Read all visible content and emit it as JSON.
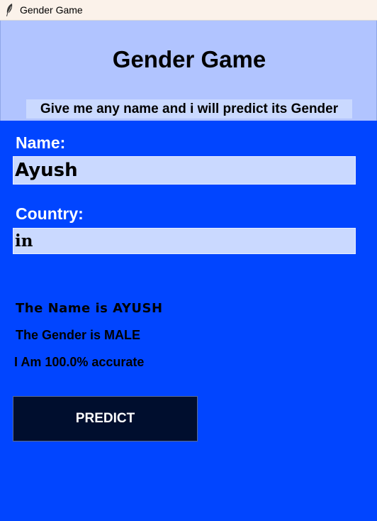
{
  "window": {
    "title": "Gender Game",
    "icon": "feather-icon"
  },
  "header": {
    "title": "Gender Game",
    "subtitle": "Give me any name and i will predict its Gender"
  },
  "form": {
    "name_label": "Name:",
    "name_value": "Ayush",
    "country_label": "Country:",
    "country_value": "in"
  },
  "results": {
    "name_text": "The Name is AYUSH",
    "gender_text": "The Gender is MALE",
    "accuracy_text": "I Am 100.0% accurate"
  },
  "actions": {
    "predict_label": "PREDICT"
  },
  "colors": {
    "header_bg": "#b1c4ff",
    "body_bg": "#0145ff",
    "input_bg": "#cad9ff",
    "button_bg": "#000e2e",
    "titlebar_bg": "#fbf2ea"
  }
}
